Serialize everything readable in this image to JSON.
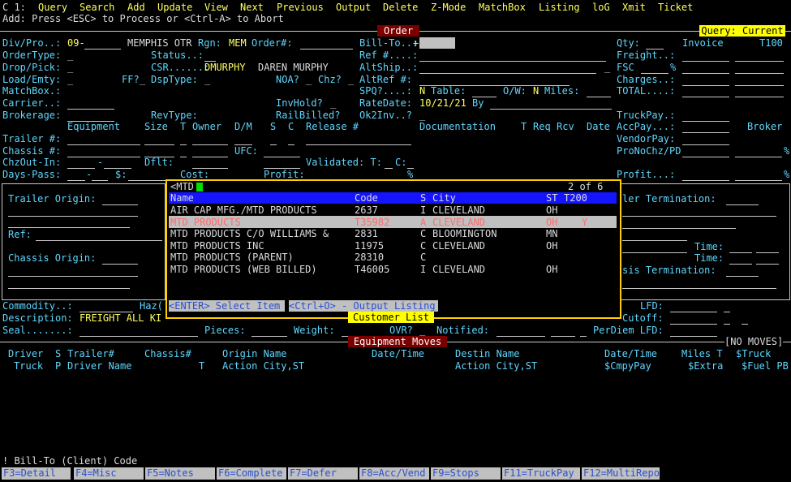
{
  "status_line": "C 1:",
  "menu": [
    "Query",
    "Search",
    "Add",
    "Update",
    "View",
    "Next",
    "Previous",
    "Output",
    "Delete",
    "Z-Mode",
    "MatchBox",
    "Listing",
    "loG",
    "Xmit",
    "Ticket"
  ],
  "mode_line": "Add: Press <ESC> to Process or <Ctrl-A> to Abort",
  "order_bar": "Order",
  "query_badge": "Query: Current",
  "fields": {
    "div_pro": "Div/Pro..:",
    "div_value": "09-",
    "div_name": "MEMPHIS OTR",
    "rgn": "Rgn:",
    "rgn_value": "MEM",
    "order_no": "Order#:",
    "bill_to": "Bill-To..:",
    "bill_to_value": "+",
    "qty": "Qty:",
    "invoice": "Invoice",
    "invoice_value": "T100",
    "order_type": "OrderType:",
    "order_type_value": "_",
    "status": "Status..:",
    "ref": "Ref #....:",
    "freight": "Freight..:",
    "drop_pick": "Drop/Pick:",
    "drop_pick_value": "_",
    "csr": "CSR......:",
    "csr_value": "DMURPHY",
    "csr_name": "DAREN MURPHY",
    "altship": "AltShip..:",
    "alt_underscore": "_",
    "fsc": "FSC",
    "fsc_pct": "%",
    "load_empty": "Load/Emty:",
    "load_empty_value": "_",
    "ff": "FF?",
    "ff_value": "_",
    "dsptype": "DspType:",
    "dsptype_value": "_",
    "noa": "NOA?",
    "noa_value": "_",
    "chz": "Chz?",
    "chz_value": "_",
    "altref": "AltRef #:",
    "charges": "Charges..:",
    "matchbox": "MatchBox.:",
    "spq": "SPQ?....:",
    "spq_value": "N",
    "table": "Table:",
    "ow": "O/W:",
    "ow_value": "N",
    "miles": "Miles:",
    "total": "TOTAL....:",
    "carrier": "Carrier..:",
    "invhold": "InvHold?",
    "invhold_value": "_",
    "ratedate": "RateDate:",
    "ratedate_value": "10/21/21",
    "by": "By",
    "brokerage": "Brokerage:",
    "revtype": "RevType:",
    "railbilled": "RailBilled?",
    "ok2inv": "Ok2Inv..?",
    "ok2inv_value": "_",
    "truckpay": "TruckPay.:",
    "equipment": "Equipment",
    "size": "Size",
    "t": "T",
    "owner": "Owner",
    "dm": "D/M",
    "s": "S",
    "c": "C",
    "release": "Release #",
    "documentation": "Documentation",
    "t2": "T",
    "req": "Req",
    "rcv": "Rcv",
    "date": "Date",
    "accpay": "AccPay...:",
    "broker": "Broker",
    "trailer": "Trailer #:",
    "vendorpay": "VendorPay:",
    "chassis": "Chassis #:",
    "ufc": "UFC:",
    "pronochz": "ProNoChz/PD",
    "pronochz_pct": "%",
    "chzout": "ChzOut-In:",
    "dash": "-",
    "dflt": "Dflt:",
    "validated": "Validated: T:",
    "validated_c": "C:",
    "dayspass": "Days-Pass:",
    "dayspass_dash": "-",
    "dollar": "$:",
    "cost": "Cost:",
    "profit": "Profit:",
    "profit_pct": "%",
    "profit_right": "Profit...:",
    "profit_right_pct": "%"
  },
  "left_panel": {
    "trailer_origin": "Trailer Origin:",
    "ref": "Ref:",
    "chassis_origin": "Chassis Origin:"
  },
  "right_panel": {
    "trailer_termination": "ler Termination:",
    "time1": "Time:",
    "time2": "Time:",
    "chassis_termination": "sis Termination:"
  },
  "popup": {
    "search_label": "<MTD",
    "page_info": "2 of 6",
    "headers": {
      "name": "Name",
      "code": "Code",
      "s": "S",
      "city": "City",
      "st": "ST",
      "t200": "T200"
    },
    "rows": [
      {
        "name": "AIR CAP MFG./MTD PRODUCTS",
        "code": "2637",
        "s": "I",
        "city": "CLEVELAND",
        "st": "OH",
        "flag": ""
      },
      {
        "name": "MTD PRODUCTS",
        "code": "T35982",
        "s": "A",
        "city": "CLEVELAND",
        "st": "OH",
        "flag": "Y"
      },
      {
        "name": "MTD PRODUCTS C/O WILLIAMS &",
        "code": "2831",
        "s": "C",
        "city": "BLOOMINGTON",
        "st": "MN",
        "flag": ""
      },
      {
        "name": "MTD PRODUCTS INC",
        "code": "11975",
        "s": "C",
        "city": "CLEVELAND",
        "st": "OH",
        "flag": ""
      },
      {
        "name": "MTD PRODUCTS (PARENT)",
        "code": "28310",
        "s": "C",
        "city": "",
        "st": "",
        "flag": ""
      },
      {
        "name": "MTD PRODUCTS (WEB BILLED)",
        "code": "T46005",
        "s": "I",
        "city": "CLEVELAND",
        "st": "OH",
        "flag": ""
      }
    ],
    "enter_hint": "<ENTER> Select Item",
    "ctrl_hint": "<Ctrl+O> - Output Listing",
    "title": "Customer List"
  },
  "lower": {
    "commodity": "Commodity..:",
    "haz": "Haz(",
    "description": "Description:",
    "description_value": "FREIGHT ALL KI",
    "seal": "Seal.......:",
    "pieces": "Pieces:",
    "weight": "Weight:",
    "ovr": "OVR?",
    "ovr_value": "_",
    "notified": "Notified:",
    "perdiem": "PerDiem LFD:",
    "lfd": "LFD:",
    "cutoff": "Cutoff:"
  },
  "moves_bar": "Equipment Moves",
  "no_moves": "[NO MOVES]",
  "moves_header1": {
    "driver": "Driver",
    "s": "S",
    "trailer": "Trailer#",
    "chassis": "Chassis#",
    "origin": "Origin Name",
    "datetime": "Date/Time",
    "destin": "Destin Name",
    "datetime2": "Date/Time",
    "miles": "Miles T",
    "struck": "$Truck"
  },
  "moves_header2": {
    "truck": "Truck",
    "p": "P",
    "driver_name": "Driver Name",
    "t": "T",
    "action1": "Action City,ST",
    "action2": "Action City,ST",
    "cmpypay": "$CmpyPay",
    "extra": "$Extra",
    "fuel": "$Fuel PB"
  },
  "hint_line": "! Bill-To (Client) Code",
  "fkeys": [
    "F3=Detail",
    "F4=Misc",
    "F5=Notes",
    "F6=Complete",
    "F7=Defer",
    "F8=Acc/Vend",
    "F9=Stops",
    "F11=TruckPay",
    "F12=MultiRepo"
  ]
}
